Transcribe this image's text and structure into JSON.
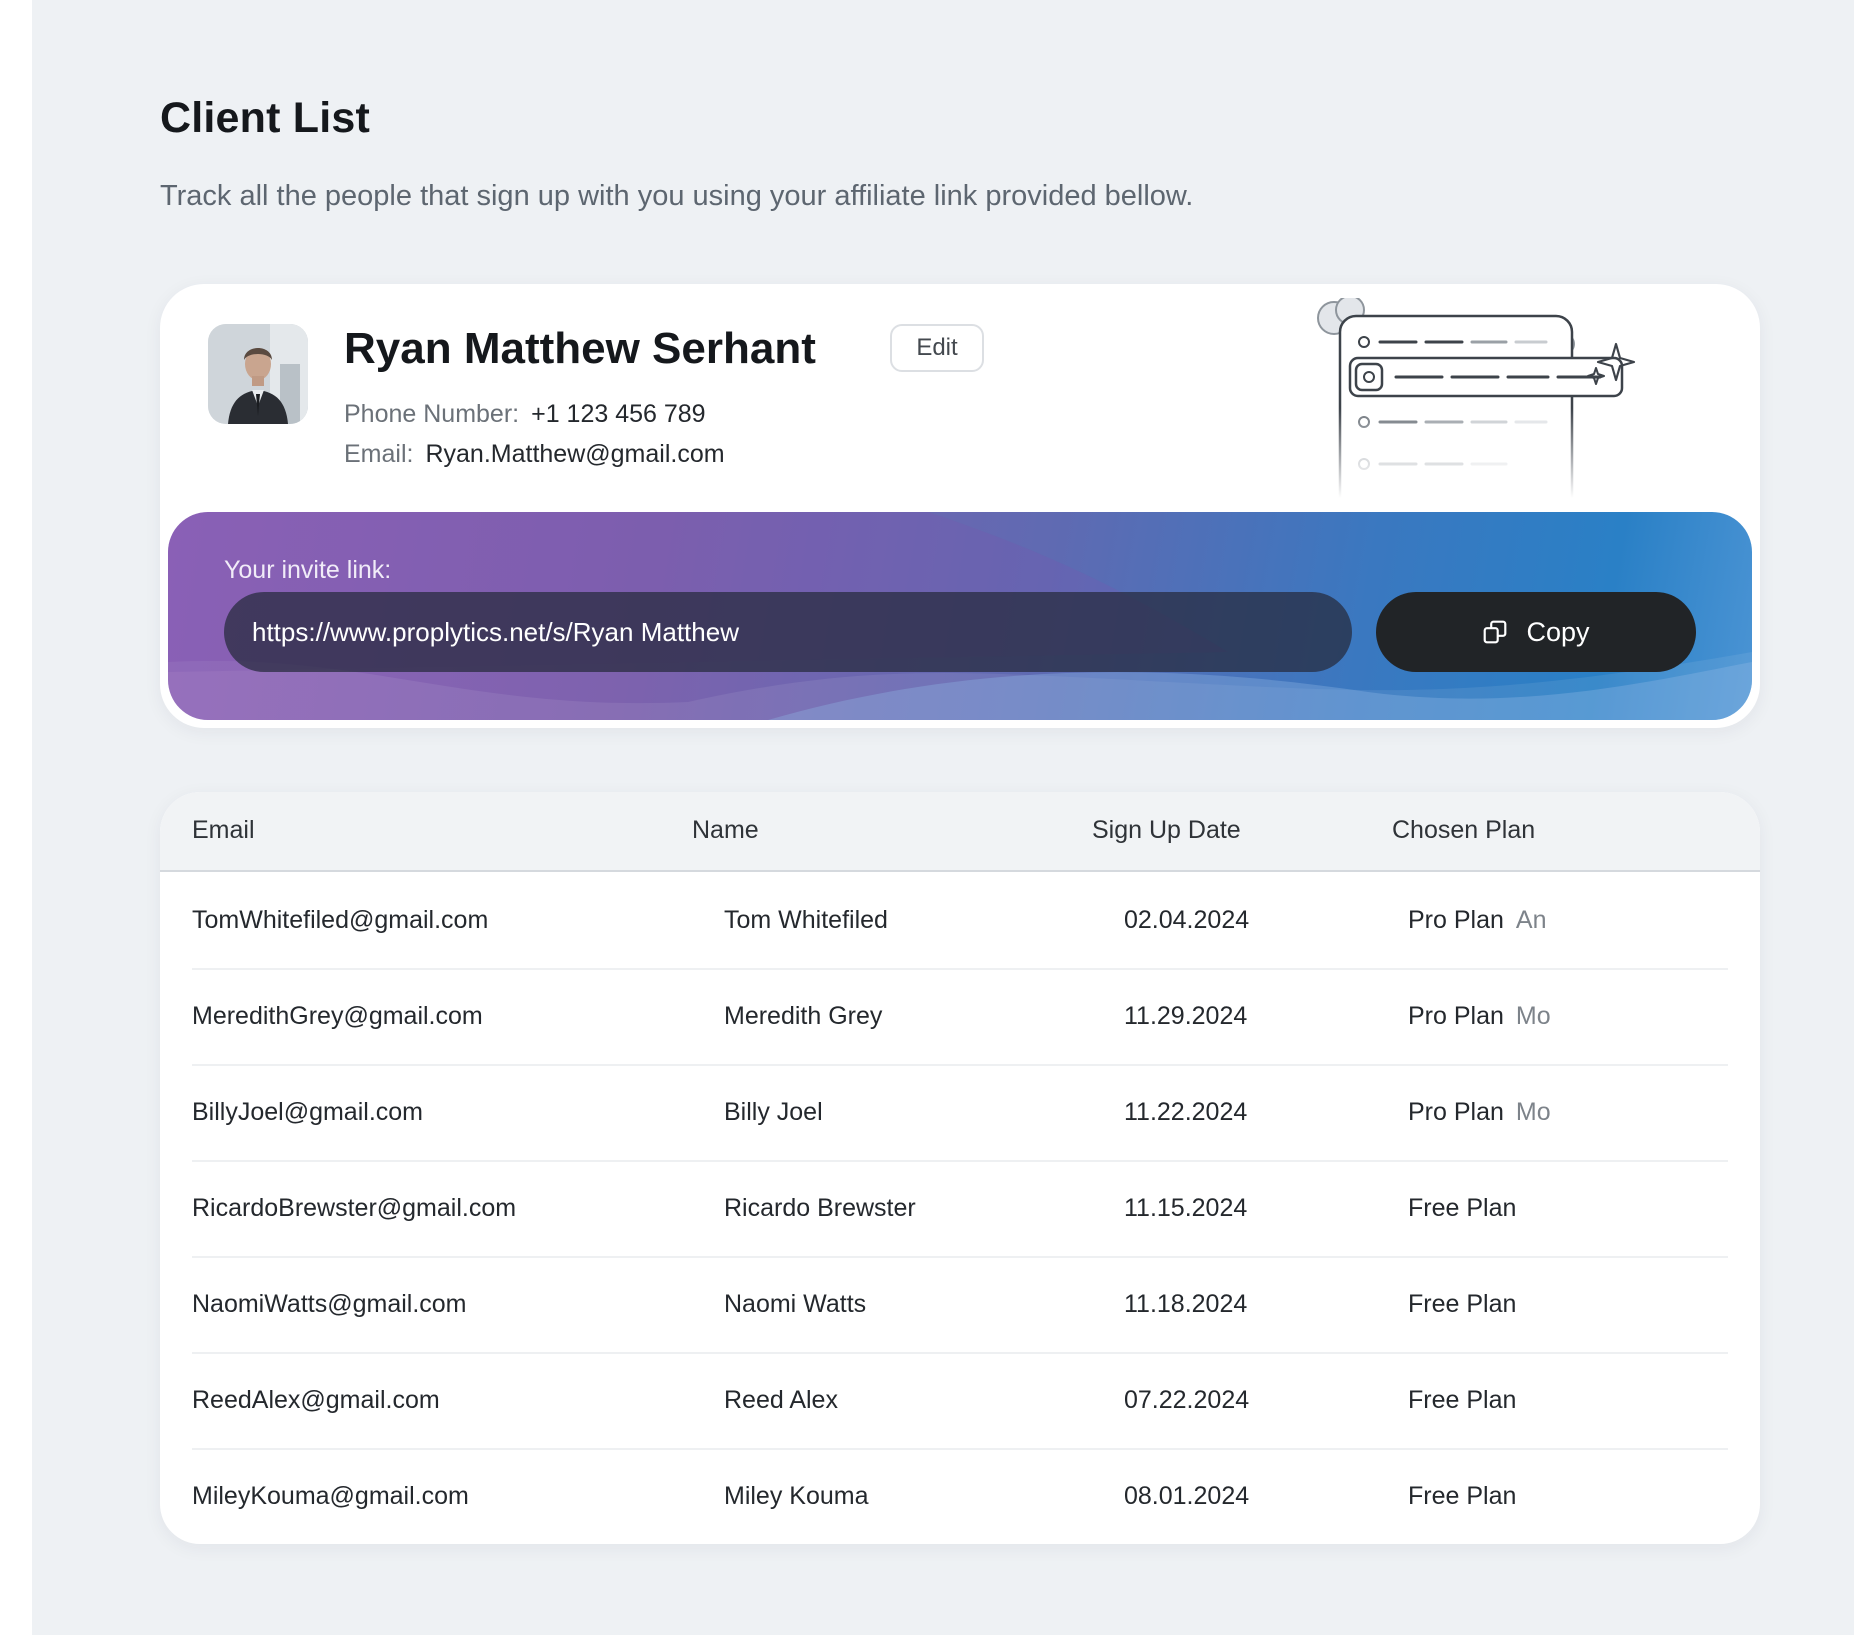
{
  "header": {
    "title": "Client List",
    "subtitle": "Track all the people that sign up with you using your affiliate link provided bellow."
  },
  "profile": {
    "name": "Ryan Matthew Serhant",
    "edit_label": "Edit",
    "phone_label": "Phone Number:",
    "phone": "+1 123 456 789",
    "email_label": "Email:",
    "email": "Ryan.Matthew@gmail.com"
  },
  "invite": {
    "label": "Your invite link:",
    "link": "https://www.proplytics.net/s/Ryan Matthew",
    "copy_label": "Copy"
  },
  "table": {
    "headers": [
      "Email",
      "Name",
      "Sign Up Date",
      "Chosen Plan"
    ],
    "rows": [
      {
        "email": "TomWhitefiled@gmail.com",
        "name": "Tom Whitefiled",
        "date": "02.04.2024",
        "plan": "Pro Plan",
        "period": "An"
      },
      {
        "email": "MeredithGrey@gmail.com",
        "name": "Meredith Grey",
        "date": "11.29.2024",
        "plan": "Pro Plan",
        "period": "Mo"
      },
      {
        "email": "BillyJoel@gmail.com",
        "name": "Billy Joel",
        "date": "11.22.2024",
        "plan": "Pro Plan",
        "period": "Mo"
      },
      {
        "email": "RicardoBrewster@gmail.com",
        "name": "Ricardo Brewster",
        "date": "11.15.2024",
        "plan": "Free Plan",
        "period": ""
      },
      {
        "email": "NaomiWatts@gmail.com",
        "name": "Naomi Watts",
        "date": "11.18.2024",
        "plan": "Free Plan",
        "period": ""
      },
      {
        "email": "ReedAlex@gmail.com",
        "name": "Reed Alex",
        "date": "07.22.2024",
        "plan": "Free Plan",
        "period": ""
      },
      {
        "email": "MileyKouma@gmail.com",
        "name": "Miley Kouma",
        "date": "08.01.2024",
        "plan": "Free Plan",
        "period": ""
      }
    ]
  },
  "icons": {
    "copy": "copy-icon",
    "avatar": "avatar",
    "illustration": "link-list-illustration"
  },
  "colors": {
    "page_bg": "#eef1f4",
    "copy_button_bg": "#212427",
    "banner_start": "#8f64b8",
    "banner_end": "#2a80c6"
  }
}
